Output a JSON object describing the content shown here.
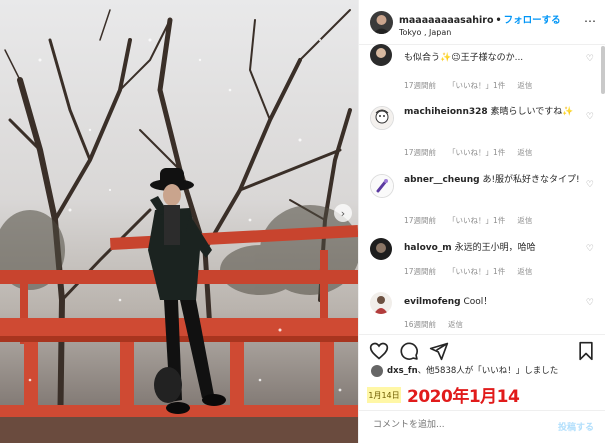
{
  "post": {
    "username": "maaaaaaaasahiro",
    "follow_label": "フォローする",
    "location": "Tokyo , Japan"
  },
  "comments": [
    {
      "user": "",
      "text": "も似合う✨😉王子様なのか...",
      "time": "17週間前",
      "likes": "「いいね！」1件",
      "reply": "返信"
    },
    {
      "user": "machiheionn328",
      "text": "素晴らしいですね✨",
      "time": "17週間前",
      "likes": "「いいね！」1件",
      "reply": "返信"
    },
    {
      "user": "abner__cheung",
      "text": "あ!服が私好きなタイプ!",
      "time": "17週間前",
      "likes": "「いいね！」1件",
      "reply": "返信"
    },
    {
      "user": "halovo_m",
      "text": "永远的王小明，哈哈",
      "time": "17週間前",
      "likes": "「いいね！」1件",
      "reply": "返信"
    },
    {
      "user": "evilmofeng",
      "text": "Cool！",
      "time": "16週間前",
      "likes": "",
      "reply": "返信"
    }
  ],
  "likes_line": {
    "user": "dxs_fn",
    "text": "、他5838人が「いいね！」しました"
  },
  "date_badge": "1月14日",
  "date_overlay": "2020年1月14",
  "comment_box": {
    "placeholder": "コメントを追加...",
    "post_label": "投稿する"
  },
  "icons": {
    "heart": "heart-icon",
    "comment": "comment-icon",
    "share": "share-icon",
    "save": "bookmark-icon",
    "more": "more-icon",
    "next": "chevron-right-icon"
  },
  "colors": {
    "accent": "#0095f6",
    "muted": "#8e8e8e",
    "overlay_date": "#e11b1b",
    "badge_bg": "#fff7a6"
  }
}
